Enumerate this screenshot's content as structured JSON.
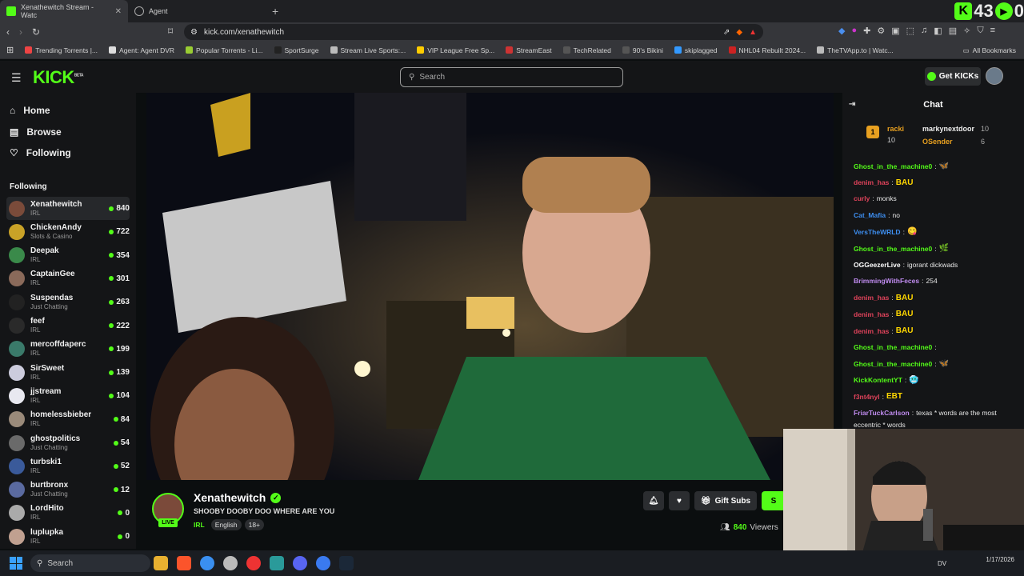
{
  "browser": {
    "tabs": [
      {
        "title": "Xenathewitch Stream - Watc",
        "active": true,
        "color": "#53fc18"
      },
      {
        "title": "Agent",
        "active": false,
        "color": "#aaaaaa"
      }
    ],
    "new_tab": "+",
    "overlay_text": {
      "left": "43",
      "right": "0"
    },
    "url": "kick.com/xenathewitch",
    "bookmarks": [
      {
        "label": "Trending Torrents |...",
        "color": "#e44"
      },
      {
        "label": "Agent: Agent DVR",
        "color": "#ddd"
      },
      {
        "label": "Popular Torrents - Li...",
        "color": "#9c3"
      },
      {
        "label": "SportSurge",
        "color": "#222"
      },
      {
        "label": "Stream Live Sports:...",
        "color": "#bbb"
      },
      {
        "label": "VIP League Free Sp...",
        "color": "#fc0"
      },
      {
        "label": "StreamEast",
        "color": "#c33"
      },
      {
        "label": "TechRelated",
        "color": "#555"
      },
      {
        "label": "90's Bikini",
        "color": "#555"
      },
      {
        "label": "skiplagged",
        "color": "#39f"
      },
      {
        "label": "NHL04 Rebuilt 2024...",
        "color": "#c22"
      },
      {
        "label": "TheTVApp.to | Watc...",
        "color": "#bbb"
      }
    ],
    "all_bookmarks": "All Bookmarks"
  },
  "kick": {
    "logo": "KICK",
    "logo_beta": "BETA",
    "search_placeholder": "Search",
    "get_kicks": "Get KICKs",
    "nav": [
      {
        "label": "Home",
        "icon": "home-icon"
      },
      {
        "label": "Browse",
        "icon": "browse-icon"
      },
      {
        "label": "Following",
        "icon": "heart-icon"
      }
    ],
    "following_title": "Following",
    "following": [
      {
        "name": "Xenathewitch",
        "category": "IRL",
        "viewers": "840",
        "color": "#7a4b3a"
      },
      {
        "name": "ChickenAndy",
        "category": "Slots & Casino",
        "viewers": "722",
        "color": "#c9a227"
      },
      {
        "name": "Deepak",
        "category": "IRL",
        "viewers": "354",
        "color": "#3a8a4a"
      },
      {
        "name": "CaptainGee",
        "category": "IRL",
        "viewers": "301",
        "color": "#8a6a5a"
      },
      {
        "name": "Suspendas",
        "category": "Just Chatting",
        "viewers": "263",
        "color": "#222222"
      },
      {
        "name": "feef",
        "category": "IRL",
        "viewers": "222",
        "color": "#2a2a2a"
      },
      {
        "name": "mercoffdaperc",
        "category": "IRL",
        "viewers": "199",
        "color": "#3a7a6a"
      },
      {
        "name": "SirSweet",
        "category": "IRL",
        "viewers": "139",
        "color": "#ccccdd"
      },
      {
        "name": "jjstream",
        "category": "IRL",
        "viewers": "104",
        "color": "#e8e8f0"
      },
      {
        "name": "homelessbieber",
        "category": "IRL",
        "viewers": "84",
        "color": "#9a8a7a"
      },
      {
        "name": "ghostpolitics",
        "category": "Just Chatting",
        "viewers": "54",
        "color": "#6a6a6a"
      },
      {
        "name": "turbski1",
        "category": "IRL",
        "viewers": "52",
        "color": "#3a5a9a"
      },
      {
        "name": "burtbronx",
        "category": "Just Chatting",
        "viewers": "12",
        "color": "#5a6aa0"
      },
      {
        "name": "LordHito",
        "category": "IRL",
        "viewers": "0",
        "color": "#aaaaaa"
      },
      {
        "name": "luplupka",
        "category": "IRL",
        "viewers": "0",
        "color": "#c0a090"
      }
    ]
  },
  "stream": {
    "name": "Xenathewitch",
    "live": "LIVE",
    "title": "SHOOBY DOOBY DOO WHERE ARE YOU",
    "category": "IRL",
    "tags": [
      "English",
      "18+"
    ],
    "gift_subs": "Gift Subs",
    "subscribe_partial": "S",
    "viewers_count": "840",
    "viewers_label": "Viewers"
  },
  "chat": {
    "title": "Chat",
    "pinned": [
      {
        "rank": "1",
        "name": "racki",
        "count": "10"
      },
      {
        "name": "markynextdoor",
        "count": "10"
      },
      {
        "name": "OSender",
        "count": "6"
      }
    ],
    "messages": [
      {
        "user": "Ghost_in_the_machine0",
        "color": "#53fc18",
        "text": "",
        "emote": "🦋"
      },
      {
        "user": "denim_has",
        "color": "#e0435b",
        "text": "",
        "emote": "BAU"
      },
      {
        "user": "curly",
        "color": "#e0435b",
        "text": "monks",
        "emote": ""
      },
      {
        "user": "Cat_Mafia",
        "color": "#3d8ef0",
        "text": "no",
        "emote": ""
      },
      {
        "user": "VersTheWRLD",
        "color": "#3d8ef0",
        "text": "",
        "emote": "😋"
      },
      {
        "user": "Ghost_in_the_machine0",
        "color": "#53fc18",
        "text": "",
        "emote": "🌿"
      },
      {
        "user": "OGGeezerLive",
        "color": "#ffffff",
        "text": "igorant dickwads",
        "emote": ""
      },
      {
        "user": "BrimmingWithFeces",
        "color": "#c08cf0",
        "text": "254",
        "emote": ""
      },
      {
        "user": "denim_has",
        "color": "#e0435b",
        "text": "",
        "emote": "BAU"
      },
      {
        "user": "denim_has",
        "color": "#e0435b",
        "text": "",
        "emote": "BAU"
      },
      {
        "user": "denim_has",
        "color": "#e0435b",
        "text": "",
        "emote": "BAU"
      },
      {
        "user": "Ghost_in_the_machine0",
        "color": "#53fc18",
        "text": "",
        "emote": ""
      },
      {
        "user": "Ghost_in_the_machine0",
        "color": "#53fc18",
        "text": "",
        "emote": "🦋"
      },
      {
        "user": "KickKontentYT",
        "color": "#53fc18",
        "text": "",
        "emote": "🥶"
      },
      {
        "user": "f3nt4nyl",
        "color": "#e0435b",
        "text": "",
        "emote": "EBT"
      },
      {
        "user": "FriarTuckCarlson",
        "color": "#c08cf0",
        "text": "texas * words are the most",
        "emote": ""
      }
    ],
    "overflow_text": "eccentric * words"
  },
  "taskbar": {
    "search": "Search",
    "lang": "DV",
    "date": "1/17/2026"
  }
}
